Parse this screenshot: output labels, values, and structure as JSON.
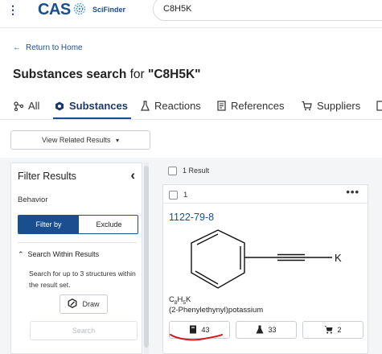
{
  "header": {
    "menu_icon": "kebab-menu-icon",
    "logo_text": "CAS",
    "logo_sub": "SciFinder",
    "search_value": "C8H5K"
  },
  "nav": {
    "return_label": "Return to Home"
  },
  "page": {
    "title_prefix": "Substances search",
    "title_for": " for ",
    "title_query": "\"C8H5K\""
  },
  "tabs": [
    {
      "label": "All",
      "icon": "hierarchy-icon"
    },
    {
      "label": "Substances",
      "icon": "hexagon-icon",
      "active": true
    },
    {
      "label": "Reactions",
      "icon": "flask-icon"
    },
    {
      "label": "References",
      "icon": "document-icon"
    },
    {
      "label": "Suppliers",
      "icon": "cart-icon"
    }
  ],
  "view_related": {
    "label": "View Related Results",
    "caret": "▾"
  },
  "filter": {
    "title": "Filter Results",
    "behavior_label": "Behavior",
    "filter_by": "Filter by",
    "exclude": "Exclude",
    "search_within_title": "Search Within Results",
    "search_within_desc": "Search for up to 3 structures within the result set.",
    "draw_label": "Draw",
    "search_label": "Search"
  },
  "results": {
    "count_label": "1 Result",
    "card": {
      "index": "1",
      "cas_rn": "1122-79-8",
      "atom_label": "K",
      "formula": {
        "c": "C",
        "c_n": "8",
        "h": "H",
        "h_n": "5",
        "k": "K"
      },
      "name": "(2-Phenylethynyl)potassium",
      "references_count": "43",
      "reactions_count": "33",
      "suppliers_count": "2"
    }
  },
  "colors": {
    "brand": "#1a4f8f",
    "annotation": "#d0191a"
  }
}
